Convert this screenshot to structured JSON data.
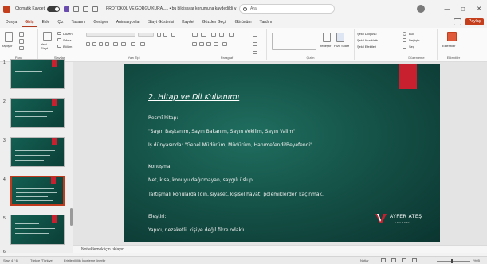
{
  "titlebar": {
    "autosave_label": "Otomatik Kaydet",
    "filename": "PROTOKOL VE GÖRGÜ KURAL...",
    "saved_status": "• bu bilgisayar konumuna kaydedildi ∨",
    "search_placeholder": "Ara",
    "min_glyph": "—",
    "max_glyph": "◻",
    "close_glyph": "✕"
  },
  "menu": {
    "tabs": [
      "Dosya",
      "Giriş",
      "Ekle",
      "Çiz",
      "Tasarım",
      "Geçişler",
      "Animasyonlar",
      "Slayt Gösterisi",
      "Kaydet",
      "Gözden Geçir",
      "Görünüm",
      "Yardım"
    ],
    "active_tab": "Giriş",
    "share_label": "Paylaş"
  },
  "ribbon": {
    "groups": [
      {
        "label": "Pano",
        "paste": "Yapıştır"
      },
      {
        "label": "Slaytlar",
        "new_slide": "Yeni Slayt",
        "layout": "Düzen",
        "reset": "Sıfırla",
        "section": "Bölüm"
      },
      {
        "label": "Yazı Tipi"
      },
      {
        "label": "Paragraf"
      },
      {
        "label": "Çizim",
        "arrange": "Yerleştir",
        "quick_styles": "Hızlı Stiller"
      },
      {
        "label": "",
        "fill": "Şekil Dolgusu",
        "outline": "Şekil Ana Hattı",
        "effects": "Şekil Efektleri"
      },
      {
        "label": "Düzenleme",
        "find": "Bul",
        "replace": "Değiştir",
        "select": "Seç"
      },
      {
        "label": "Eklentiler",
        "addins": "Eklentiler"
      }
    ]
  },
  "slides": [
    {
      "num": "1"
    },
    {
      "num": "2"
    },
    {
      "num": "3"
    },
    {
      "num": "4",
      "selected": true
    },
    {
      "num": "5"
    },
    {
      "num": "6"
    }
  ],
  "slide": {
    "title": "2. Hitap ve Dil Kullanımı",
    "lines": [
      "Resmî hitap:",
      "\"Sayın Başkanım, Sayın Bakanım, Sayın Vekilim, Sayın Valim\"",
      "İş dünyasında: \"Genel Müdürüm, Müdürüm, Hanımefendi/Beyefendi\"",
      "Konuşma:",
      "Net, kısa, konuyu dağıtmayan, saygılı üslup.",
      "Tartışmalı konularda (din, siyaset, kişisel hayat) polemiklerden kaçınmak.",
      "Eleştiri:",
      "Yapıcı, nezaketli, kişiye değil fikre odaklı."
    ],
    "logo_text": "AYFER ATEŞ",
    "logo_sub": "AKADEMİ",
    "accent_color": "#c8202f"
  },
  "notes": {
    "placeholder": "Not eklemek için tıklayın"
  },
  "status": {
    "slide_info": "Slayt 4 / 6",
    "language": "Türkçe (Türkiye)",
    "accessibility": "Erişilebilirlik: İnceleme önerilir",
    "notes_label": "Notlar",
    "zoom": "%95"
  }
}
